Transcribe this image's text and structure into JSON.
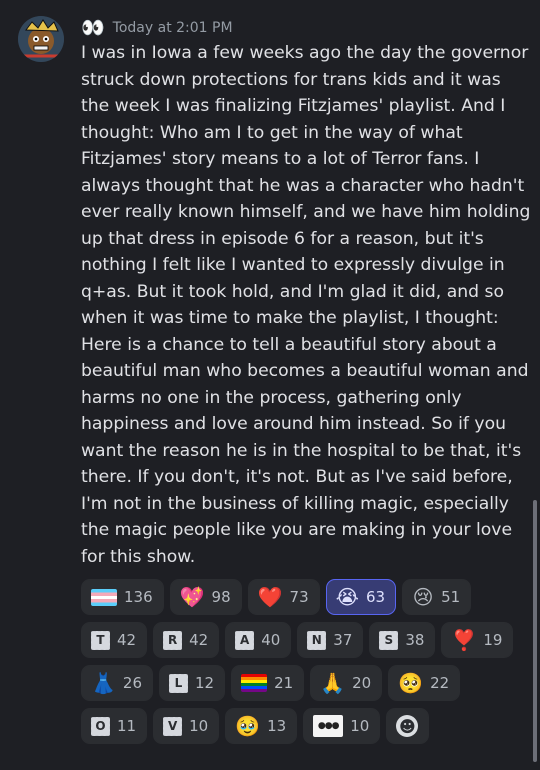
{
  "message": {
    "header_emoji": "👀",
    "timestamp": "Today at 2:01 PM",
    "text": "I was in Iowa a few weeks ago the day the governor struck down protections for trans kids and it was the week I was finalizing Fitzjames' playlist. And I thought: Who am I to get in the way of what Fitzjames' story means to a lot of Terror fans. I always thought that he was a character who hadn't ever really known himself, and we have him holding up that dress in episode 6 for a reason, but it's nothing I felt like I wanted to expressly divulge in q+as. But it took hold, and I'm glad it did, and so when it was time to make the playlist, I thought: Here is a chance to tell a beautiful story about a beautiful man who becomes a beautiful woman and harms no one in the process, gathering only happiness and love around him instead. So if you want the reason he is in the hospital to be that, it's there. If you don't, it's not. But as I've said before, I'm not in the business of killing magic, especially the magic people like you are making in your love for this show."
  },
  "reactions": [
    {
      "kind": "flag",
      "icon": "transgender-flag-icon",
      "count": "136"
    },
    {
      "kind": "emoji",
      "emoji": "💖",
      "icon": "sparkling-heart-icon",
      "count": "98"
    },
    {
      "kind": "emoji",
      "emoji": "❤️",
      "icon": "red-heart-icon",
      "count": "73"
    },
    {
      "kind": "emoji",
      "emoji": "😭",
      "icon": "loudly-crying-face-icon",
      "count": "63",
      "selected": true
    },
    {
      "kind": "emoji",
      "emoji": "😢",
      "icon": "crying-face-icon",
      "count": "51"
    },
    {
      "kind": "letter",
      "letter": "T",
      "icon": "letter-t-icon",
      "count": "42"
    },
    {
      "kind": "letter",
      "letter": "R",
      "icon": "letter-r-icon",
      "count": "42"
    },
    {
      "kind": "letter",
      "letter": "A",
      "icon": "letter-a-icon",
      "count": "40"
    },
    {
      "kind": "letter",
      "letter": "N",
      "icon": "letter-n-icon",
      "count": "37"
    },
    {
      "kind": "letter",
      "letter": "S",
      "icon": "letter-s-icon",
      "count": "38"
    },
    {
      "kind": "emoji",
      "emoji": "❣️",
      "icon": "heart-exclamation-icon",
      "count": "19"
    },
    {
      "kind": "emoji",
      "emoji": "👗",
      "icon": "dress-icon",
      "count": "26"
    },
    {
      "kind": "letter",
      "letter": "L",
      "icon": "letter-l-icon",
      "count": "12"
    },
    {
      "kind": "pride",
      "icon": "rainbow-flag-icon",
      "count": "21"
    },
    {
      "kind": "emoji",
      "emoji": "🙏",
      "icon": "folded-hands-icon",
      "count": "20"
    },
    {
      "kind": "emoji",
      "emoji": "🥺",
      "icon": "pleading-face-icon",
      "count": "22"
    },
    {
      "kind": "letter",
      "letter": "O",
      "icon": "letter-o-icon",
      "count": "11"
    },
    {
      "kind": "letter",
      "letter": "V",
      "icon": "letter-v-icon",
      "count": "10"
    },
    {
      "kind": "emoji",
      "emoji": "🥹",
      "icon": "face-holding-back-tears-icon",
      "count": "13"
    },
    {
      "kind": "sticker",
      "icon": "custom-sticker-icon",
      "count": "10"
    },
    {
      "kind": "add",
      "icon": "add-reaction-icon",
      "count": ""
    }
  ],
  "colors": {
    "background": "#1e1f24",
    "reaction_bg": "#2b2d31",
    "reaction_selected_bg": "#373c74",
    "reaction_selected_border": "#5865f2",
    "timestamp": "#949ba4"
  }
}
